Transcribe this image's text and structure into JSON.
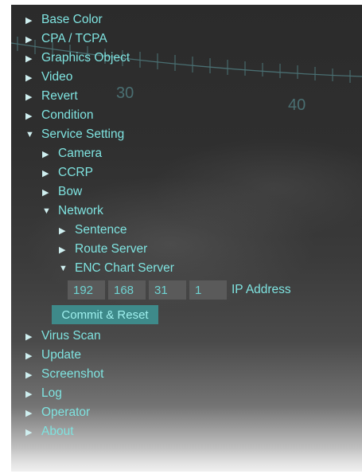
{
  "compass": {
    "label_left": "30",
    "label_right": "40"
  },
  "icons": {
    "collapsed": "triangle-right",
    "expanded": "triangle-down",
    "collapsed_glyph": "▶",
    "expanded_glyph": "▼"
  },
  "menu": {
    "base_color": "Base Color",
    "cpa_tcpa": "CPA / TCPA",
    "graphics_object": "Graphics Object",
    "video": "Video",
    "revert": "Revert",
    "condition": "Condition",
    "service_setting": "Service Setting",
    "camera": "Camera",
    "ccrp": "CCRP",
    "bow": "Bow",
    "network": "Network",
    "sentence": "Sentence",
    "route_server": "Route Server",
    "enc_chart_server": "ENC Chart Server",
    "virus_scan": "Virus Scan",
    "update": "Update",
    "screenshot": "Screenshot",
    "log": "Log",
    "operator": "Operator",
    "about": "About"
  },
  "enc": {
    "ip_octets": [
      "192",
      "168",
      "31",
      "1"
    ],
    "ip_label": "IP Address",
    "commit_label": "Commit & Reset"
  },
  "colors": {
    "text": "#7fe3e0",
    "button": "#3e8a8a",
    "field": "#5a5a5a"
  }
}
